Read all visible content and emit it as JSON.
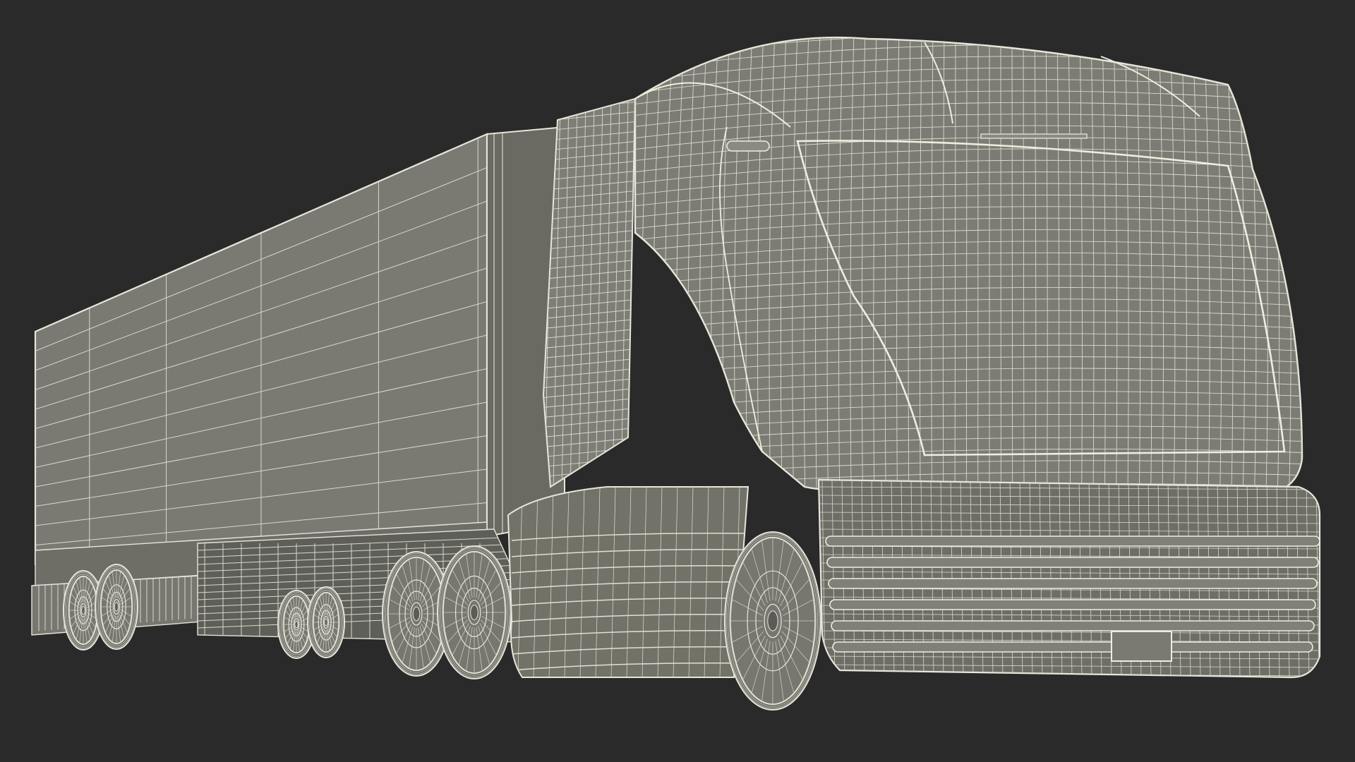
{
  "scene": {
    "subject": "semi-truck-with-trailer-wireframe",
    "colors": {
      "background": "#2a2a2a",
      "surface": "#7a7a72",
      "surface_dark": "#6a6a63",
      "surface_light": "#8a8a81",
      "wire": "#e6e6da",
      "wire_dim": "#c8c8bc"
    }
  }
}
